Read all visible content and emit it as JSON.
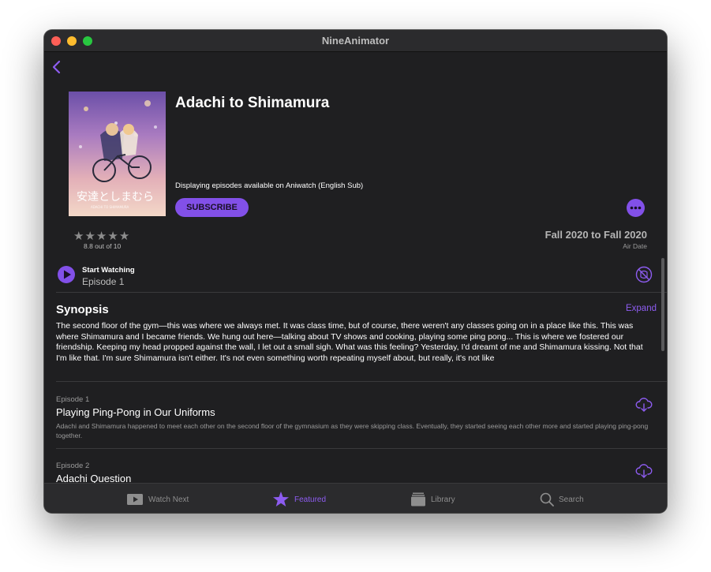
{
  "window": {
    "title": "NineAnimator"
  },
  "anime": {
    "title": "Adachi to Shimamura",
    "source_note": "Displaying episodes available on Aniwatch (English Sub)",
    "subscribe_label": "SUBSCRIBE",
    "rating": {
      "stars_filled": 5,
      "text": "8.8 out of 10"
    },
    "air": {
      "range": "Fall 2020 to Fall 2020",
      "label": "Air Date"
    },
    "cover": {
      "title_jp": "安達としまむら",
      "subtitle": "ADACHI TO SHIMAMURA"
    }
  },
  "start_watching": {
    "label": "Start Watching",
    "episode": "Episode 1"
  },
  "synopsis": {
    "title": "Synopsis",
    "expand_label": "Expand",
    "text": "The second floor of the gym—this was where we always met. It was class time, but of course, there weren't any classes going on in a place like this. This was where Shimamura and I became friends. We hung out here—talking about TV shows and cooking, playing some ping pong... This is where we fostered our friendship. Keeping my head propped against the wall, I let out a small sigh. What was this feeling? Yesterday, I'd dreamt of me and Shimamura kissing. Not that I'm like that. I'm sure Shimamura isn't either. It's not even something worth repeating myself about, but really, it's not like"
  },
  "episodes": [
    {
      "number": "Episode 1",
      "title": "Playing Ping-Pong in Our Uniforms",
      "description": "Adachi and Shimamura happened to meet each other on the second floor of the gymnasium as they were skipping class. Eventually, they started seeing each other more and started playing ping-pong together."
    },
    {
      "number": "Episode 2",
      "title": "Adachi Question",
      "description": ""
    }
  ],
  "tabs": [
    {
      "label": "Watch Next",
      "icon": "play-tv-icon",
      "active": false
    },
    {
      "label": "Featured",
      "icon": "star-icon",
      "active": true
    },
    {
      "label": "Library",
      "icon": "library-icon",
      "active": false
    },
    {
      "label": "Search",
      "icon": "search-icon",
      "active": false
    }
  ],
  "colors": {
    "accent": "#8250e8",
    "background": "#1f1f21",
    "tabbar": "#2b2b2d"
  }
}
